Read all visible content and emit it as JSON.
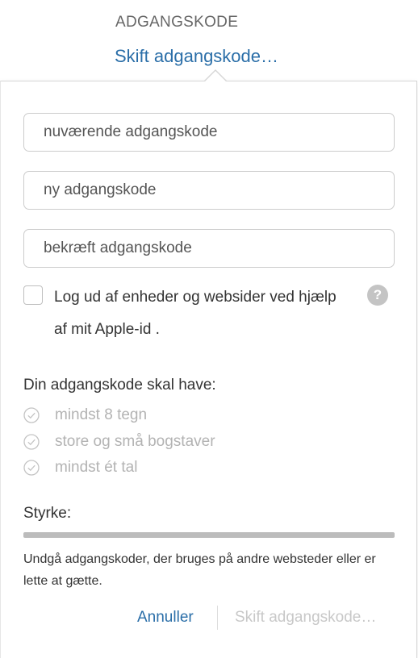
{
  "header": {
    "section_title": "ADGANGSKODE",
    "change_link": "Skift adgangskode…"
  },
  "form": {
    "current_password_placeholder": "nuværende adgangskode",
    "new_password_placeholder": "ny adgangskode",
    "confirm_password_placeholder": "bekræft adgangskode",
    "logout_checkbox_checked": false,
    "logout_label": "Log ud af enheder og websider ved hjælp af mit Apple-id .",
    "help_icon_glyph": "?"
  },
  "requirements": {
    "title": "Din adgangskode skal have:",
    "items": [
      {
        "label": "mindst 8 tegn",
        "met": false
      },
      {
        "label": "store og små bogstaver",
        "met": false
      },
      {
        "label": "mindst ét tal",
        "met": false
      }
    ]
  },
  "strength": {
    "label": "Styrke:",
    "level_fraction": 0
  },
  "hint": "Undgå adgangskoder, der bruges på andre websteder eller er lette at gætte.",
  "footer": {
    "cancel_label": "Annuller",
    "submit_label": "Skift adgangskode…"
  },
  "colors": {
    "link": "#2a6ea8",
    "muted": "#b3b3b3",
    "disabled": "#c8c8c8"
  },
  "icons": {
    "requirement": "check-circle-icon",
    "help": "question-mark-icon"
  }
}
